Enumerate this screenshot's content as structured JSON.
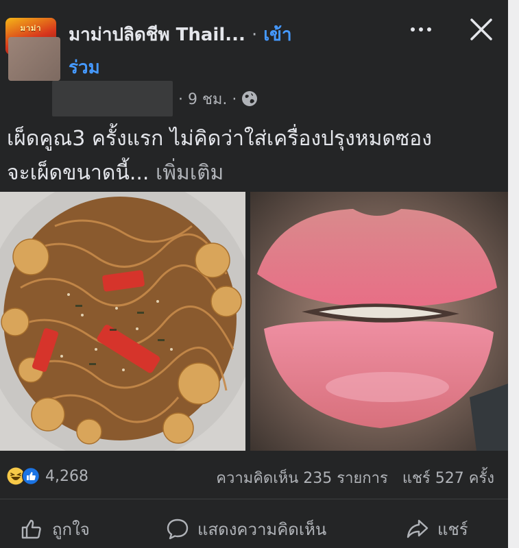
{
  "header": {
    "group_name": "มาม่าปลิดชีพ Thail...",
    "separator": "·",
    "join_part1": "เข้า",
    "join_part2": "ร่วม",
    "logo_text": "มาม่า",
    "more_icon": "more-dots-icon",
    "close_icon": "close-icon"
  },
  "meta": {
    "time": "· 9 ชม. ·",
    "privacy_icon": "globe-icon"
  },
  "post": {
    "text_line1": "เผ็ดคูณ3 ครั้งแรก ไม่คิดว่าใส่เครื่องปรุงหมดซอง",
    "text_line2": "จะเผ็ดขนาดนี้...",
    "see_more": "เพิ่มเติม"
  },
  "stats": {
    "reaction_count": "4,268",
    "comments": "ความคิดเห็น 235 รายการ",
    "shares": "แชร์ 527 ครั้ง"
  },
  "actions": {
    "like": "ถูกใจ",
    "comment": "แสดงความคิดเห็น",
    "share": "แชร์"
  },
  "colors": {
    "card_bg": "#242526",
    "primary_text": "#e4e6eb",
    "secondary_text": "#b0b3b8",
    "link_blue": "#4599ff"
  }
}
